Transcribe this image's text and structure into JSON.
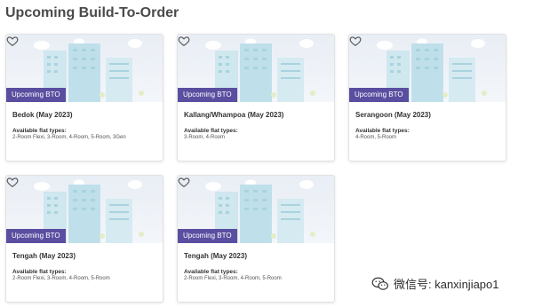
{
  "page": {
    "title": "Upcoming Build-To-Order"
  },
  "cards": [
    {
      "tag": "Upcoming BTO",
      "title": "Bedok (May 2023)",
      "flat_label": "Available flat types:",
      "flat_types": "2-Room Flexi, 3-Room, 4-Room, 5-Room, 3Gen"
    },
    {
      "tag": "Upcoming BTO",
      "title": "Kallang/Whampoa (May 2023)",
      "flat_label": "Available flat types:",
      "flat_types": "3-Room, 4-Room"
    },
    {
      "tag": "Upcoming BTO",
      "title": "Serangoon (May 2023)",
      "flat_label": "Available flat types:",
      "flat_types": "4-Room, 5-Room"
    },
    {
      "tag": "Upcoming BTO",
      "title": "Tengah (May 2023)",
      "flat_label": "Available flat types:",
      "flat_types": "2-Room Flexi, 3-Room, 4-Room, 5-Room"
    },
    {
      "tag": "Upcoming BTO",
      "title": "Tengah (May 2023)",
      "flat_label": "Available flat types:",
      "flat_types": "2-Room Flexi, 3-Room, 4-Room, 5-Room"
    }
  ],
  "watermark": {
    "text": "微信号: kanxinjiapo1"
  },
  "icons": {
    "favorite": "heart-outline-icon",
    "watermark": "wechat-icon"
  },
  "colors": {
    "tag_bg": "#5a4ea0",
    "building": "#bfe0ea",
    "title": "#4a4a4a"
  }
}
